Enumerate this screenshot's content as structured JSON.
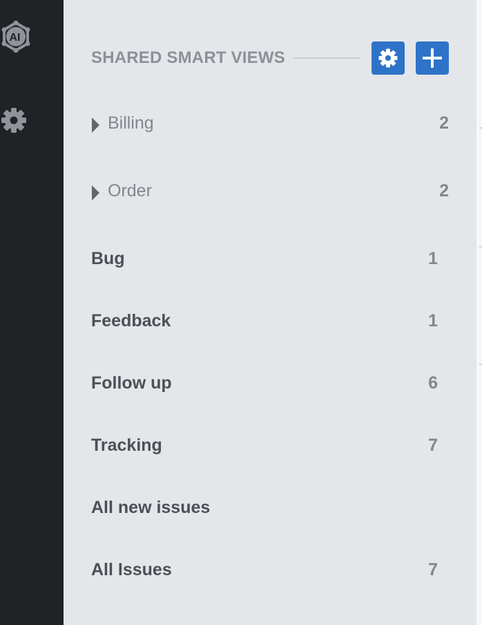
{
  "sidebar": {
    "icons": [
      "ai-logo-icon",
      "gear-icon"
    ]
  },
  "section": {
    "title": "SHARED SMART VIEWS",
    "settings_icon": "gear-icon",
    "add_icon": "plus-icon"
  },
  "groups": [
    {
      "label": "Billing",
      "count": "2"
    },
    {
      "label": "Order",
      "count": "2"
    }
  ],
  "views": [
    {
      "label": "Bug",
      "count": "1"
    },
    {
      "label": "Feedback",
      "count": "1"
    },
    {
      "label": "Follow up",
      "count": "6"
    },
    {
      "label": "Tracking",
      "count": "7"
    },
    {
      "label": "All new issues",
      "count": ""
    },
    {
      "label": "All Issues",
      "count": "7"
    }
  ],
  "colors": {
    "rail_bg": "#202226",
    "panel_bg": "#e4e6e9",
    "accent": "#2e73c8",
    "muted_text": "#81878e",
    "strong_text": "#4b5057"
  }
}
